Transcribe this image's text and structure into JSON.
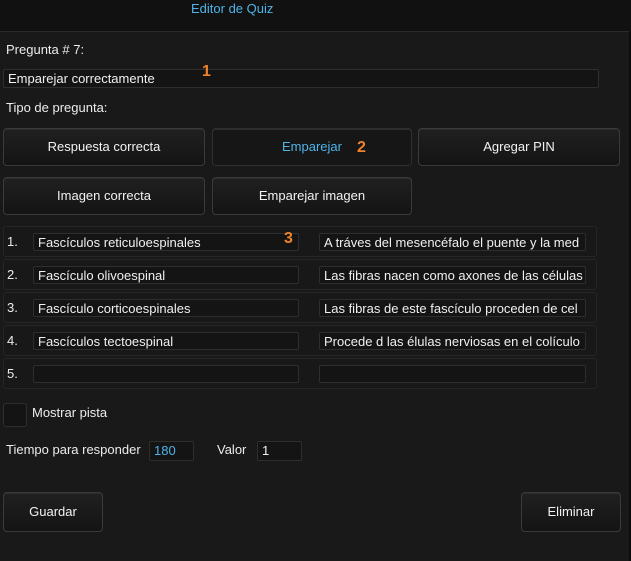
{
  "window": {
    "title": "Editor de Quiz"
  },
  "question": {
    "number_label": "Pregunta # 7:",
    "text": "Emparejar correctamente",
    "type_label": "Tipo de pregunta:"
  },
  "question_types": [
    {
      "label": "Respuesta correcta"
    },
    {
      "label": "Emparejar",
      "active": true
    },
    {
      "label": "Agregar PIN"
    },
    {
      "label": "Imagen correcta"
    },
    {
      "label": "Emparejar imagen"
    }
  ],
  "markers": [
    "1",
    "2",
    "3"
  ],
  "pairs": [
    {
      "num": "1.",
      "left": "Fascículos reticuloespinales",
      "right": "A tráves del mesencéfalo el puente y la med"
    },
    {
      "num": "2.",
      "left": "Fascículo olivoespinal",
      "right": "Las fibras nacen como axones de las células"
    },
    {
      "num": "3.",
      "left": "Fascículo corticoespinales",
      "right": "Las fibras de este fascículo proceden de cel"
    },
    {
      "num": "4.",
      "left": "Fascículos tectoespinal",
      "right": "Procede d las élulas nerviosas en el colículo"
    },
    {
      "num": "5.",
      "left": "",
      "right": ""
    }
  ],
  "hint": {
    "label": "Mostrar pista",
    "checked": false
  },
  "timing": {
    "time_label": "Tiempo para responder",
    "time_value": "180",
    "value_label": "Valor",
    "value_value": "1"
  },
  "actions": {
    "save": "Guardar",
    "delete": "Eliminar"
  },
  "colors": {
    "accent": "#4fb3e8",
    "marker": "#f0822a",
    "background": "#191919"
  }
}
